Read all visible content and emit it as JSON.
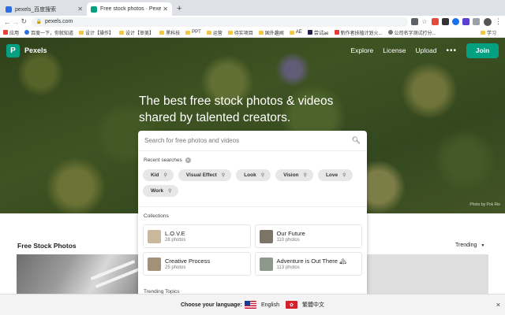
{
  "browser": {
    "tabs": [
      {
        "title": "pexels_百度搜索",
        "favicon_color": "#2f6ee0",
        "active": false
      },
      {
        "title": "Free stock photos · Pexels",
        "favicon_color": "#05a081",
        "active": true
      }
    ],
    "new_tab": "+",
    "url": "pexels.com",
    "bookmarks": [
      "应用",
      "百度一下，你就知道",
      "设计【操作】",
      "设计【审美】",
      "黑科技",
      "PPT",
      "运营",
      "待实项目",
      "国外趣闻",
      "AE",
      "尝试ae",
      "新作者扶植计划火...",
      "公司名字测试打分...",
      "学习"
    ]
  },
  "header": {
    "logo_letter": "P",
    "logo_text": "Pexels",
    "nav": [
      "Explore",
      "License",
      "Upload"
    ],
    "more": "•••",
    "join": "Join"
  },
  "hero": {
    "headline_line1": "The best free stock photos & videos",
    "headline_line2": "shared by talented creators.",
    "credit": "Photo by Pok Rie"
  },
  "search": {
    "placeholder": "Search for free photos and videos",
    "recent_label": "Recent searches",
    "recent": [
      "Kid",
      "Visual Effect",
      "Look",
      "Vision",
      "Love",
      "Work"
    ],
    "collections_label": "Collections",
    "collections": [
      {
        "name": "L.O.V.E",
        "count": "28 photos",
        "thumb_color": "#c9b89a"
      },
      {
        "name": "Our Future",
        "count": "110 photos",
        "thumb_color": "#7d7468"
      },
      {
        "name": "Creative Process",
        "count": "25 photos",
        "thumb_color": "#a39079"
      },
      {
        "name": "Adventure is Out There 🏔",
        "count": "113 photos",
        "thumb_color": "#8b9a8c"
      }
    ],
    "trending_label": "Trending Topics"
  },
  "main": {
    "title": "Free Stock Photos",
    "sort_value": "Trending"
  },
  "language_bar": {
    "label": "Choose your language:",
    "options": [
      "English",
      "繁體中文"
    ],
    "close": "×"
  }
}
